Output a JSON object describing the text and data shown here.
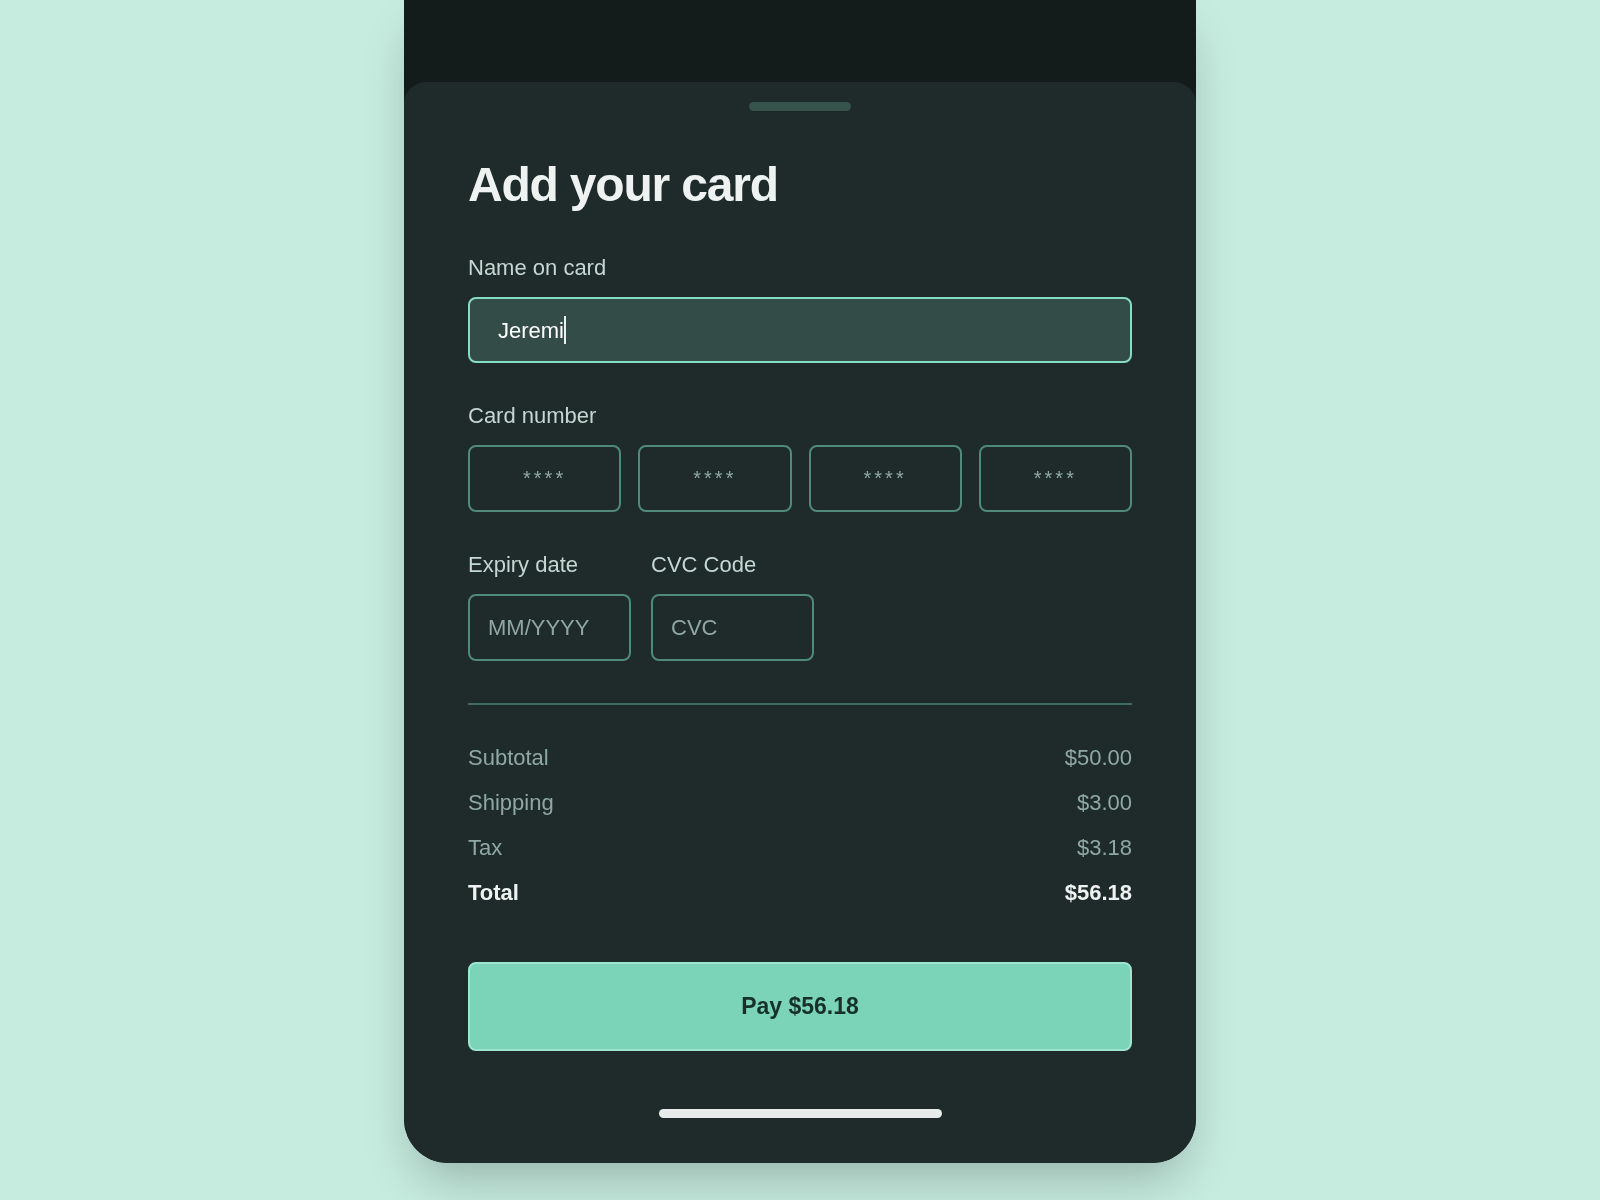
{
  "sheet": {
    "title": "Add your card"
  },
  "name_field": {
    "label": "Name on card",
    "value": "Jeremi",
    "focused": true
  },
  "card_number": {
    "label": "Card number",
    "segments": [
      {
        "placeholder": "****"
      },
      {
        "placeholder": "****"
      },
      {
        "placeholder": "****"
      },
      {
        "placeholder": "****"
      }
    ]
  },
  "expiry": {
    "label": "Expiry date",
    "placeholder": "MM/YYYY"
  },
  "cvc": {
    "label": "CVC Code",
    "placeholder": "CVC"
  },
  "summary": [
    {
      "kind": "line",
      "label": "Subtotal",
      "value": "$50.00"
    },
    {
      "kind": "line",
      "label": "Shipping",
      "value": "$3.00"
    },
    {
      "kind": "line",
      "label": "Tax",
      "value": "$3.18"
    },
    {
      "kind": "total",
      "label": "Total",
      "value": "$56.18"
    }
  ],
  "pay_button": {
    "label": "Pay $56.18"
  }
}
